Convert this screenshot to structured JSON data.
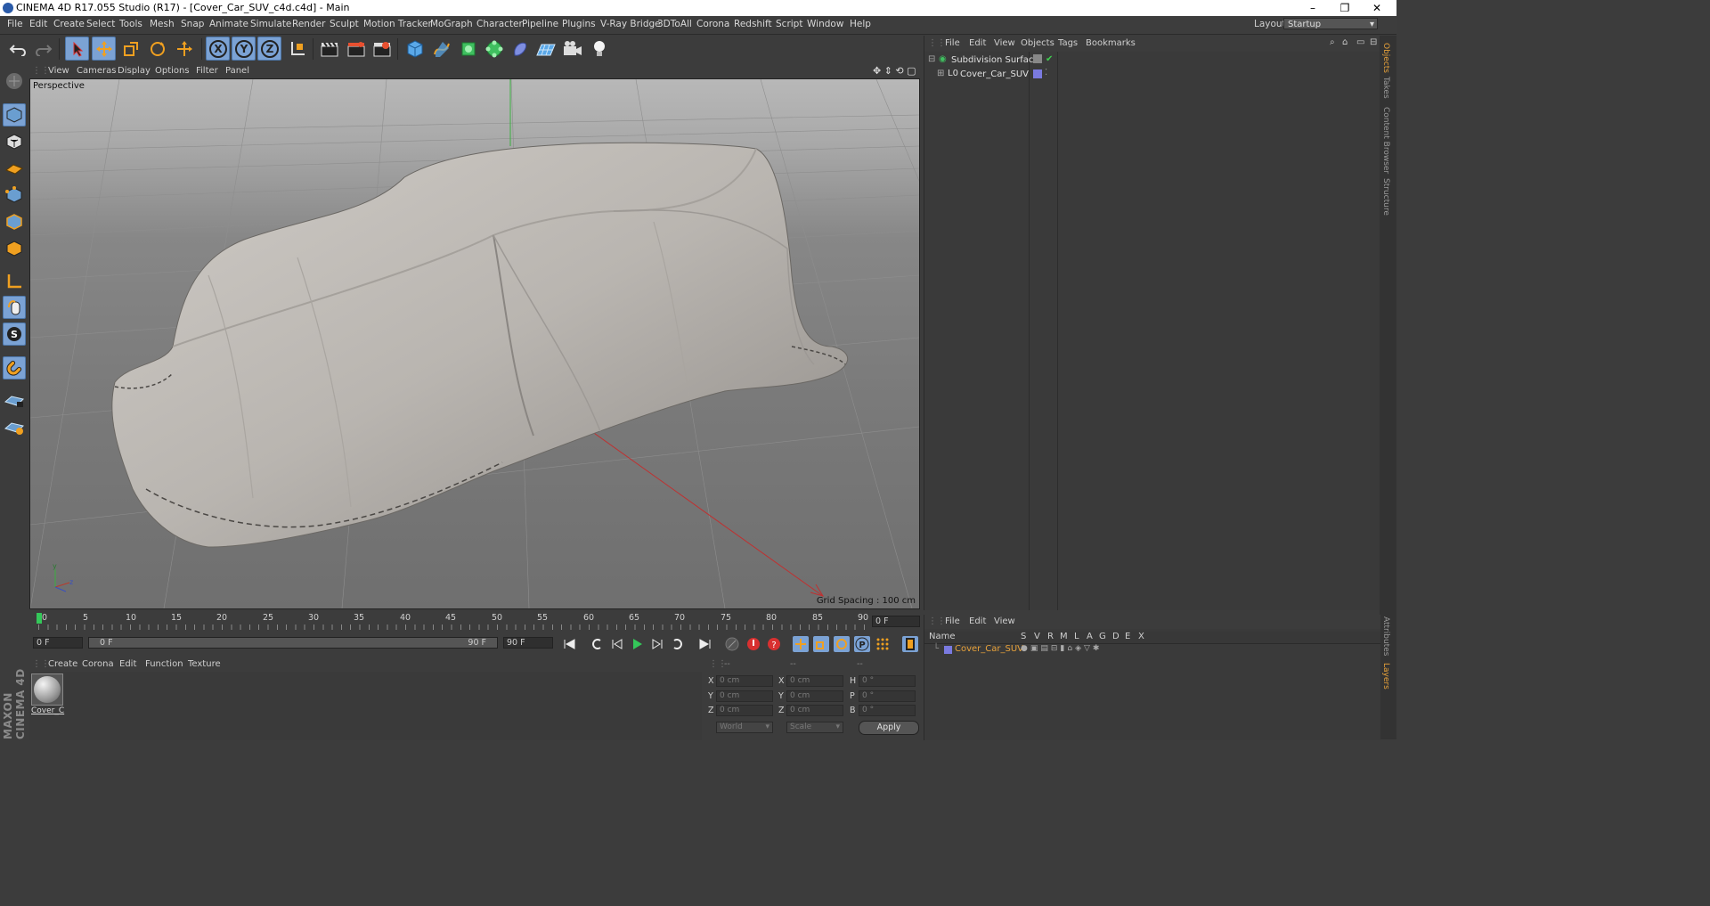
{
  "window": {
    "title": "CINEMA 4D R17.055 Studio (R17) - [Cover_Car_SUV_c4d.c4d] - Main",
    "controls": [
      "–",
      "❐",
      "✕"
    ]
  },
  "menubar": {
    "items": [
      "File",
      "Edit",
      "Create",
      "Select",
      "Tools",
      "Mesh",
      "Snap",
      "Animate",
      "Simulate",
      "Render",
      "Sculpt",
      "Motion Tracker",
      "MoGraph",
      "Character",
      "Pipeline",
      "Plugins",
      "V-Ray Bridge",
      "3DToAll",
      "Corona",
      "Redshift",
      "Script",
      "Window",
      "Help"
    ],
    "layout_label": "Layout:",
    "layout_value": "Startup"
  },
  "toolbar": {
    "axis_x": "X",
    "axis_y": "Y",
    "axis_z": "Z"
  },
  "left_toolbar": {
    "snap_s": "S"
  },
  "viewport": {
    "menu": [
      "View",
      "Cameras",
      "Display",
      "Options",
      "Filter",
      "Panel"
    ],
    "label": "Perspective",
    "grid_spacing": "Grid Spacing : 100 cm",
    "axis_y": "y",
    "axis_z": "z"
  },
  "objects_panel": {
    "menu": [
      "File",
      "Edit",
      "View",
      "Objects",
      "Tags",
      "Bookmarks"
    ],
    "items": [
      {
        "name": "Subdivision Surface"
      },
      {
        "name": "Cover_Car_SUV"
      }
    ]
  },
  "right_tabs": [
    "Objects",
    "Takes",
    "Content Browser",
    "Structure"
  ],
  "right_tabs_bottom": [
    "Attributes",
    "Layers"
  ],
  "timeline": {
    "ticks": [
      "0",
      "5",
      "10",
      "15",
      "20",
      "25",
      "30",
      "35",
      "40",
      "45",
      "50",
      "55",
      "60",
      "65",
      "70",
      "75",
      "80",
      "85",
      "90"
    ],
    "current_frame_display": "0 F"
  },
  "anim": {
    "start": "0 F",
    "range_start": "0 F",
    "range_end": "90 F",
    "end": "90 F"
  },
  "material_panel": {
    "menu": [
      "Create",
      "Corona",
      "Edit",
      "Function",
      "Texture"
    ],
    "material_name": "Cover_C"
  },
  "coords": {
    "headers": [
      "--",
      "--",
      "--"
    ],
    "rows": [
      {
        "a": "X",
        "av": "0 cm",
        "b": "X",
        "bv": "0 cm",
        "c": "H",
        "cv": "0 °"
      },
      {
        "a": "Y",
        "av": "0 cm",
        "b": "Y",
        "bv": "0 cm",
        "c": "P",
        "cv": "0 °"
      },
      {
        "a": "Z",
        "av": "0 cm",
        "b": "Z",
        "bv": "0 cm",
        "c": "B",
        "cv": "0 °"
      }
    ],
    "mode": "World",
    "transform": "Scale",
    "apply": "Apply"
  },
  "layers_panel": {
    "menu": [
      "File",
      "Edit",
      "View"
    ],
    "columns": [
      "Name",
      "S",
      "V",
      "R",
      "M",
      "L",
      "A",
      "G",
      "D",
      "E",
      "X"
    ],
    "row_name": "Cover_Car_SUV"
  },
  "branding": {
    "logo_text": "MAXON CINEMA 4D"
  },
  "colors": {
    "accent_selected": "#7ba2d4",
    "layer_name": "#e8a23a",
    "playhead": "#34c759"
  }
}
